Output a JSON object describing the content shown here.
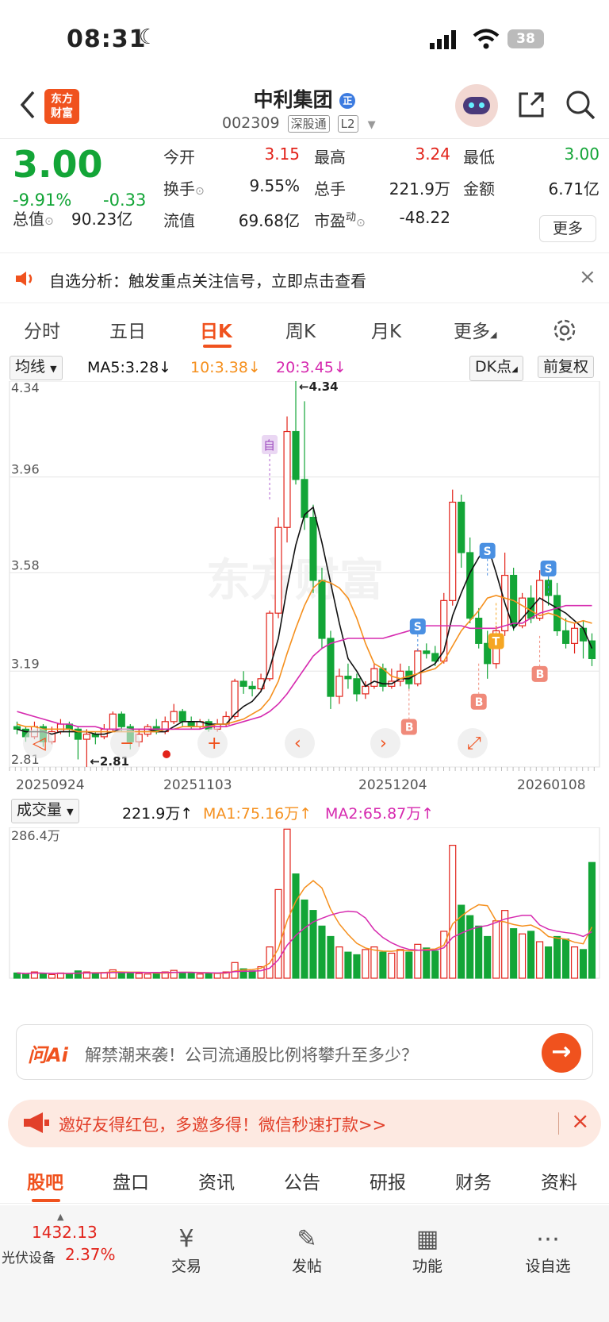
{
  "status": {
    "time": "08:31",
    "battery": "38"
  },
  "header": {
    "title": "中利集团",
    "code": "002309",
    "market_tag": "深股通",
    "level_tag": "L2",
    "logo_line1": "东方",
    "logo_line2": "财富",
    "badge": "正"
  },
  "quote": {
    "price": "3.00",
    "pct": "-9.91%",
    "chg": "-0.33",
    "open_lbl": "今开",
    "open": "3.15",
    "high_lbl": "最高",
    "high": "3.24",
    "low_lbl": "最低",
    "low": "3.00",
    "turnover_lbl": "换手",
    "turnover": "9.55%",
    "vol_lbl": "总手",
    "vol": "221.9万",
    "amount_lbl": "金额",
    "amount": "6.71亿",
    "mcap_lbl": "总值",
    "mcap": "90.23亿",
    "float_lbl": "流值",
    "float": "69.68亿",
    "pe_lbl": "市盈",
    "pe_sup": "动",
    "pe": "-48.22",
    "more": "更多"
  },
  "notice": {
    "text": "自选分析：触发重点关注信号，立即点击查看"
  },
  "tabs": [
    "分时",
    "五日",
    "日K",
    "周K",
    "月K",
    "更多"
  ],
  "active_tab": "日K",
  "ma": {
    "select": "均线",
    "ma5": "MA5:3.28↓",
    "ma10": "10:3.38↓",
    "ma20": "20:3.45↓",
    "dk": "DK点",
    "fq": "前复权"
  },
  "axis": {
    "y": [
      "4.34",
      "3.96",
      "3.58",
      "3.19",
      "2.81"
    ],
    "x": [
      "20250924",
      "20251103",
      "20251204",
      "20260108"
    ],
    "max_label": "←4.34",
    "min_label": "←2.81",
    "self_marker": "自",
    "watermark": "东方财富"
  },
  "vol_ctl": {
    "select": "成交量",
    "vol": "221.9万↑",
    "ma1": "MA1:75.16万↑",
    "ma2": "MA2:65.87万↑",
    "max": "286.4万"
  },
  "chart_data": {
    "type": "candlestick",
    "ylim": [
      2.81,
      4.34
    ],
    "candles": [
      [
        2.97,
        2.96,
        2.99,
        2.94
      ],
      [
        2.96,
        2.93,
        2.97,
        2.91
      ],
      [
        2.93,
        2.97,
        2.99,
        2.92
      ],
      [
        2.97,
        2.91,
        2.98,
        2.89
      ],
      [
        2.91,
        2.95,
        2.97,
        2.9
      ],
      [
        2.95,
        2.98,
        3.0,
        2.94
      ],
      [
        2.98,
        2.96,
        2.99,
        2.93
      ],
      [
        2.96,
        2.92,
        2.97,
        2.84
      ],
      [
        2.92,
        2.94,
        2.96,
        2.81
      ],
      [
        2.94,
        2.93,
        2.95,
        2.9
      ],
      [
        2.93,
        2.96,
        2.98,
        2.92
      ],
      [
        2.96,
        3.02,
        3.03,
        2.95
      ],
      [
        3.02,
        2.97,
        3.03,
        2.95
      ],
      [
        2.97,
        2.91,
        2.98,
        2.88
      ],
      [
        2.91,
        2.94,
        2.96,
        2.89
      ],
      [
        2.94,
        2.97,
        2.98,
        2.93
      ],
      [
        2.97,
        2.95,
        3.0,
        2.94
      ],
      [
        2.95,
        2.99,
        3.01,
        2.94
      ],
      [
        2.99,
        3.03,
        3.06,
        2.98
      ],
      [
        3.03,
        2.99,
        3.04,
        2.97
      ],
      [
        2.99,
        2.97,
        3.01,
        2.96
      ],
      [
        2.97,
        2.99,
        3.0,
        2.96
      ],
      [
        2.99,
        2.96,
        3.0,
        2.95
      ],
      [
        2.96,
        2.98,
        3.0,
        2.95
      ],
      [
        2.98,
        3.01,
        3.03,
        2.97
      ],
      [
        3.01,
        3.15,
        3.16,
        3.0
      ],
      [
        3.15,
        3.13,
        3.19,
        3.1
      ],
      [
        3.13,
        3.12,
        3.15,
        3.09
      ],
      [
        3.12,
        3.16,
        3.18,
        3.11
      ],
      [
        3.16,
        3.42,
        3.43,
        3.15
      ],
      [
        3.42,
        3.76,
        3.8,
        3.4
      ],
      [
        3.76,
        4.14,
        4.2,
        3.7
      ],
      [
        4.14,
        3.95,
        4.34,
        3.93
      ],
      [
        3.95,
        3.8,
        4.26,
        3.75
      ],
      [
        3.8,
        3.55,
        3.85,
        3.5
      ],
      [
        3.55,
        3.32,
        3.6,
        3.28
      ],
      [
        3.32,
        3.09,
        3.35,
        3.04
      ],
      [
        3.09,
        3.17,
        3.2,
        3.06
      ],
      [
        3.17,
        3.16,
        3.22,
        3.12
      ],
      [
        3.16,
        3.1,
        3.18,
        3.07
      ],
      [
        3.1,
        3.13,
        3.15,
        3.08
      ],
      [
        3.13,
        3.2,
        3.22,
        3.12
      ],
      [
        3.2,
        3.13,
        3.22,
        3.11
      ],
      [
        3.13,
        3.15,
        3.2,
        3.12
      ],
      [
        3.15,
        3.19,
        3.22,
        3.13
      ],
      [
        3.19,
        3.14,
        3.21,
        3.12
      ],
      [
        3.14,
        3.27,
        3.28,
        3.13
      ],
      [
        3.27,
        3.26,
        3.3,
        3.24
      ],
      [
        3.26,
        3.23,
        3.29,
        3.21
      ],
      [
        3.23,
        3.47,
        3.5,
        3.22
      ],
      [
        3.47,
        3.86,
        3.91,
        3.45
      ],
      [
        3.86,
        3.66,
        3.89,
        3.6
      ],
      [
        3.66,
        3.4,
        3.72,
        3.38
      ],
      [
        3.4,
        3.3,
        3.44,
        3.28
      ],
      [
        3.3,
        3.22,
        3.35,
        3.16
      ],
      [
        3.22,
        3.35,
        3.37,
        3.2
      ],
      [
        3.35,
        3.57,
        3.66,
        3.33
      ],
      [
        3.57,
        3.37,
        3.6,
        3.35
      ],
      [
        3.37,
        3.48,
        3.5,
        3.36
      ],
      [
        3.48,
        3.4,
        3.53,
        3.38
      ],
      [
        3.4,
        3.55,
        3.59,
        3.39
      ],
      [
        3.55,
        3.49,
        3.62,
        3.45
      ],
      [
        3.49,
        3.35,
        3.54,
        3.33
      ],
      [
        3.35,
        3.3,
        3.4,
        3.28
      ],
      [
        3.3,
        3.36,
        3.38,
        3.26
      ],
      [
        3.36,
        3.31,
        3.39,
        3.24
      ],
      [
        3.31,
        3.24,
        3.34,
        3.21
      ]
    ],
    "volumes": [
      10,
      8,
      12,
      9,
      7,
      10,
      8,
      14,
      12,
      9,
      11,
      16,
      12,
      10,
      9,
      8,
      10,
      12,
      15,
      11,
      9,
      8,
      10,
      9,
      12,
      30,
      18,
      14,
      22,
      60,
      170,
      286,
      200,
      150,
      130,
      100,
      80,
      60,
      50,
      45,
      55,
      60,
      50,
      48,
      55,
      50,
      65,
      58,
      52,
      90,
      255,
      140,
      120,
      100,
      80,
      110,
      130,
      95,
      85,
      90,
      70,
      60,
      80,
      75,
      60,
      55,
      222
    ],
    "ma5": [
      2.96,
      2.95,
      2.95,
      2.95,
      2.94,
      2.95,
      2.95,
      2.95,
      2.95,
      2.94,
      2.94,
      2.95,
      2.96,
      2.96,
      2.96,
      2.96,
      2.95,
      2.95,
      2.97,
      2.99,
      2.99,
      2.99,
      2.98,
      2.98,
      2.98,
      3.02,
      3.05,
      3.07,
      3.11,
      3.2,
      3.32,
      3.52,
      3.69,
      3.81,
      3.84,
      3.7,
      3.54,
      3.38,
      3.24,
      3.19,
      3.13,
      3.15,
      3.14,
      3.14,
      3.16,
      3.16,
      3.18,
      3.2,
      3.22,
      3.27,
      3.41,
      3.5,
      3.58,
      3.64,
      3.69,
      3.58,
      3.46,
      3.36,
      3.4,
      3.44,
      3.48,
      3.46,
      3.44,
      3.42,
      3.39,
      3.36,
      3.28
    ],
    "ma10": [
      2.98,
      2.97,
      2.97,
      2.96,
      2.96,
      2.96,
      2.96,
      2.95,
      2.95,
      2.95,
      2.95,
      2.95,
      2.95,
      2.95,
      2.95,
      2.95,
      2.95,
      2.96,
      2.96,
      2.97,
      2.97,
      2.97,
      2.97,
      2.98,
      2.98,
      2.99,
      3.0,
      3.02,
      3.04,
      3.08,
      3.15,
      3.26,
      3.36,
      3.45,
      3.52,
      3.55,
      3.54,
      3.52,
      3.48,
      3.4,
      3.3,
      3.22,
      3.2,
      3.17,
      3.16,
      3.17,
      3.18,
      3.19,
      3.2,
      3.23,
      3.29,
      3.35,
      3.39,
      3.43,
      3.48,
      3.49,
      3.48,
      3.47,
      3.45,
      3.43,
      3.41,
      3.42,
      3.41,
      3.39,
      3.38,
      3.39,
      3.38
    ],
    "ma20": [
      3.03,
      3.02,
      3.01,
      3.0,
      2.99,
      2.98,
      2.98,
      2.97,
      2.97,
      2.97,
      2.96,
      2.96,
      2.96,
      2.96,
      2.96,
      2.96,
      2.96,
      2.96,
      2.96,
      2.96,
      2.96,
      2.96,
      2.97,
      2.97,
      2.97,
      2.98,
      2.99,
      3.0,
      3.01,
      3.03,
      3.06,
      3.1,
      3.15,
      3.2,
      3.25,
      3.28,
      3.3,
      3.31,
      3.32,
      3.32,
      3.32,
      3.32,
      3.32,
      3.33,
      3.34,
      3.35,
      3.36,
      3.37,
      3.37,
      3.37,
      3.37,
      3.37,
      3.36,
      3.36,
      3.36,
      3.36,
      3.37,
      3.38,
      3.38,
      3.4,
      3.42,
      3.43,
      3.44,
      3.45,
      3.45,
      3.45,
      3.45
    ]
  },
  "signals": {
    "S": "S",
    "B": "B",
    "T": "T"
  },
  "ai": {
    "brand": "问Ai",
    "text": "解禁潮来袭！公司流通股比例将攀升至多少？"
  },
  "promo": {
    "text": "邀好友得红包，多邀多得！微信秒速打款>>"
  },
  "btabs": [
    "股吧",
    "盘口",
    "资讯",
    "公告",
    "研报",
    "财务",
    "资料"
  ],
  "bottom": {
    "index_value": "1432.13",
    "index_name": "光伏设备",
    "index_pct": "2.37%",
    "trade": "交易",
    "post": "发帖",
    "func": "功能",
    "watch": "设自选"
  },
  "colors": {
    "up": "#e2231a",
    "down": "#13a537",
    "accent": "#f0521e",
    "ma5": "#111111",
    "ma10": "#f5901e",
    "ma20": "#d62aaf"
  }
}
